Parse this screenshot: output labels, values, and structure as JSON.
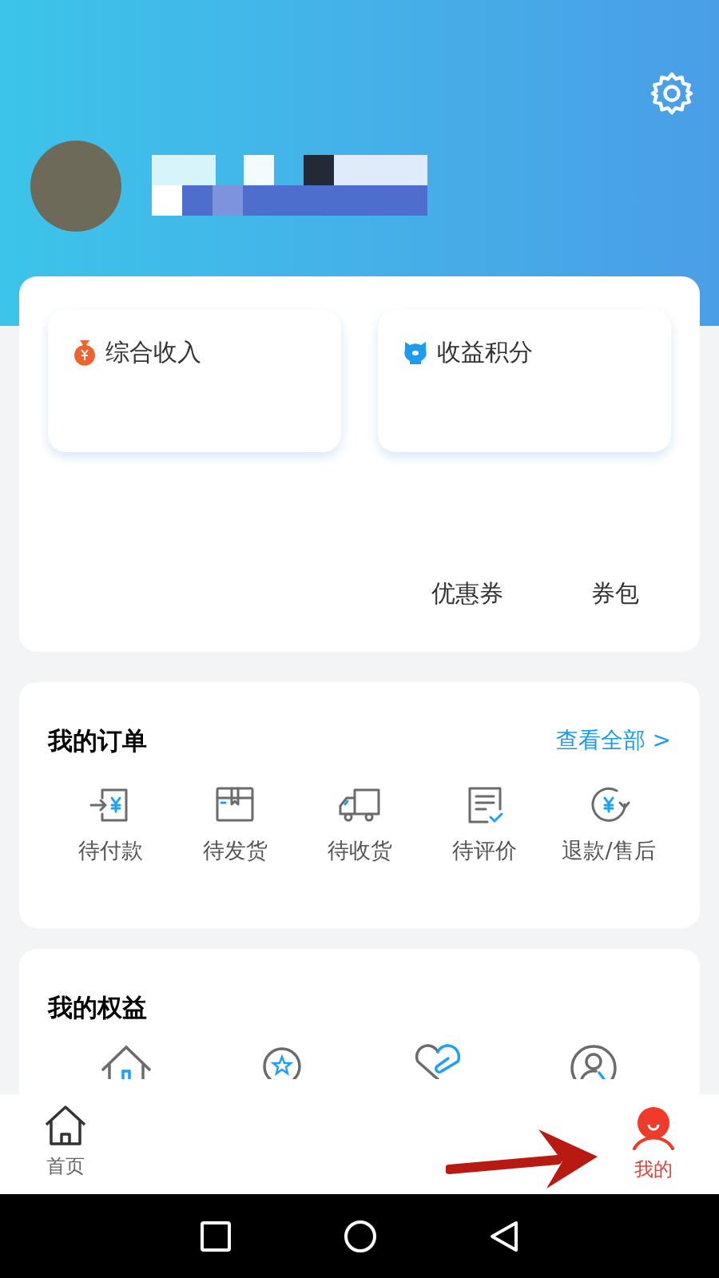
{
  "income_cards": [
    {
      "kind": "bag",
      "label": "综合收入"
    },
    {
      "kind": "piggy",
      "label": "收益积分"
    }
  ],
  "coupon_links": [
    "优惠券",
    "券包"
  ],
  "orders": {
    "title": "我的订单",
    "view_all": "查看全部 >",
    "items": [
      {
        "kind": "pay",
        "label": "待付款"
      },
      {
        "kind": "box",
        "label": "待发货"
      },
      {
        "kind": "truck",
        "label": "待收货"
      },
      {
        "kind": "review",
        "label": "待评价"
      },
      {
        "kind": "refund",
        "label": "退款/售后"
      }
    ]
  },
  "benefits": {
    "title": "我的权益",
    "items": [
      {
        "kind": "house"
      },
      {
        "kind": "badge"
      },
      {
        "kind": "heart"
      },
      {
        "kind": "person"
      }
    ]
  },
  "bottom_nav": [
    {
      "kind": "home",
      "label": "首页",
      "selected": false
    },
    {
      "kind": "me",
      "label": "我的",
      "selected": true
    }
  ]
}
